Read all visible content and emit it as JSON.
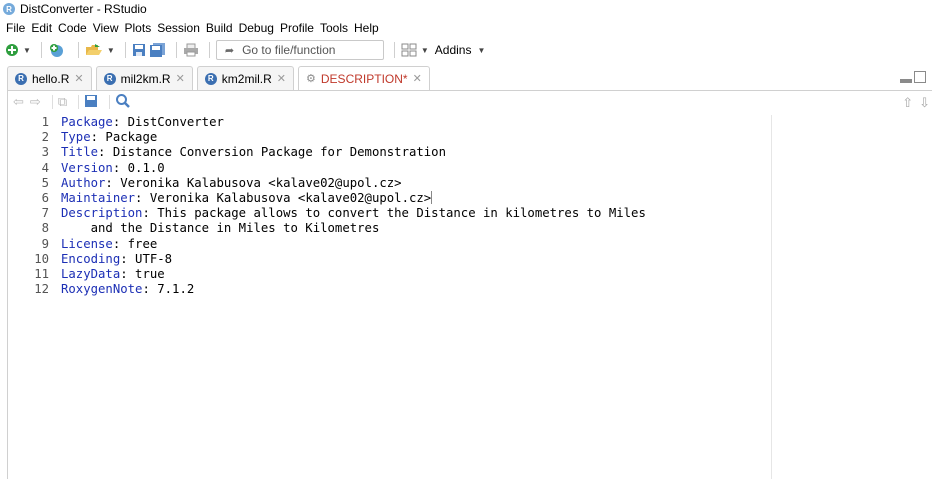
{
  "window": {
    "title": "DistConverter - RStudio"
  },
  "menu": [
    "File",
    "Edit",
    "Code",
    "View",
    "Plots",
    "Session",
    "Build",
    "Debug",
    "Profile",
    "Tools",
    "Help"
  ],
  "toolbar": {
    "goto_placeholder": "Go to file/function",
    "addins_label": "Addins"
  },
  "tabs": [
    {
      "label": "hello.R",
      "icon": "r-file-icon",
      "active": false
    },
    {
      "label": "mil2km.R",
      "icon": "r-file-icon",
      "active": false
    },
    {
      "label": "km2mil.R",
      "icon": "r-file-icon",
      "active": false
    },
    {
      "label": "DESCRIPTION*",
      "icon": "gear-icon",
      "active": true
    }
  ],
  "colors": {
    "key": "#1c2fb5",
    "active_tab_text": "#c0392b"
  },
  "code_lines": [
    {
      "n": "1",
      "key": "Package",
      "val": " DistConverter"
    },
    {
      "n": "2",
      "key": "Type",
      "val": " Package"
    },
    {
      "n": "3",
      "key": "Title",
      "val": " Distance Conversion Package for Demonstration"
    },
    {
      "n": "4",
      "key": "Version",
      "val": " 0.1.0"
    },
    {
      "n": "5",
      "key": "Author",
      "val": " Veronika Kalabusova <kalave02@upol.cz>"
    },
    {
      "n": "6",
      "key": "Maintainer",
      "val": " Veronika Kalabusova <kalave02@upol.cz>"
    },
    {
      "n": "7",
      "key": "Description",
      "val": " This package allows to convert the Distance in kilometres to Miles"
    },
    {
      "n": "8",
      "key": "",
      "val": "    and the Distance in Miles to Kilometres"
    },
    {
      "n": "9",
      "key": "License",
      "val": " free"
    },
    {
      "n": "10",
      "key": "Encoding",
      "val": " UTF-8"
    },
    {
      "n": "11",
      "key": "LazyData",
      "val": " true"
    },
    {
      "n": "12",
      "key": "RoxygenNote",
      "val": " 7.1.2"
    }
  ]
}
